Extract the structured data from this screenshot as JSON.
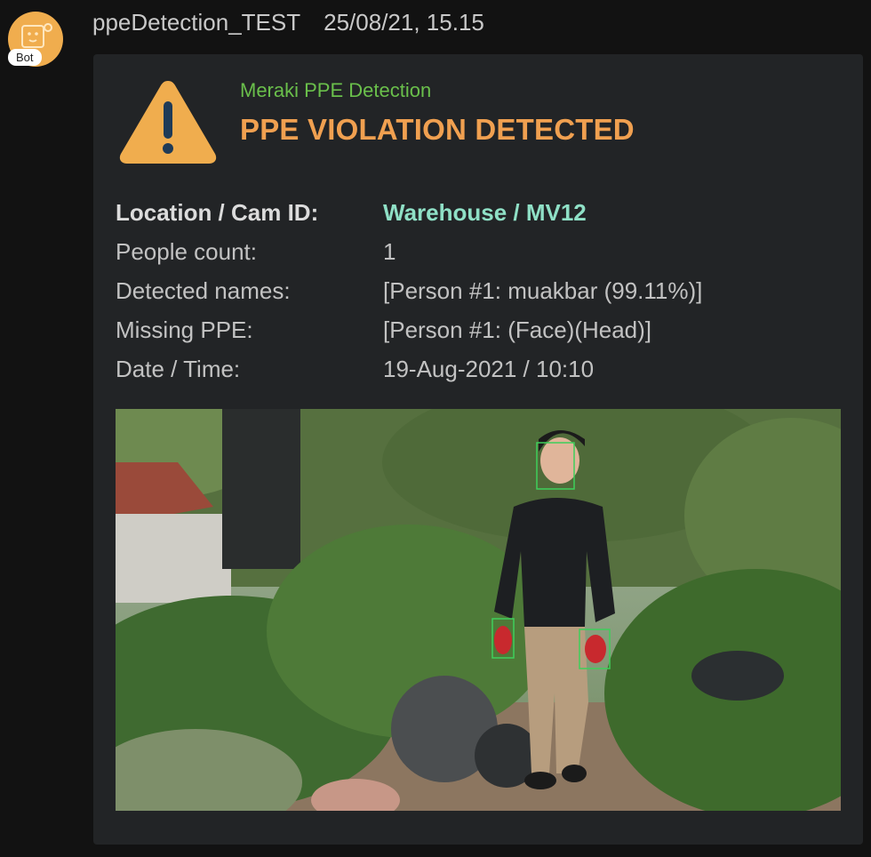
{
  "sender": {
    "name": "ppeDetection_TEST",
    "timestamp": "25/08/21, 15.15",
    "badge": "Bot"
  },
  "card": {
    "source": "Meraki PPE Detection",
    "title": "PPE VIOLATION DETECTED",
    "facts": [
      {
        "label": "Location / Cam ID:",
        "value": "Warehouse / MV12"
      },
      {
        "label": "People count:",
        "value": "1"
      },
      {
        "label": "Detected names:",
        "value": "[Person #1: muakbar (99.11%)]"
      },
      {
        "label": "Missing PPE:",
        "value": "[Person #1: (Face)(Head)]"
      },
      {
        "label": "Date / Time:",
        "value": "19-Aug-2021 / 10:10"
      }
    ],
    "colors": {
      "source": "#6abf4b",
      "title": "#f0a050",
      "highlight_value": "#8fe0c6",
      "warning_icon": "#f0ad4e",
      "detection_box": "#3ecf5a"
    },
    "image": {
      "icon": "camera-snapshot-image",
      "detection_boxes": [
        "face",
        "left-hand",
        "right-hand"
      ]
    }
  }
}
